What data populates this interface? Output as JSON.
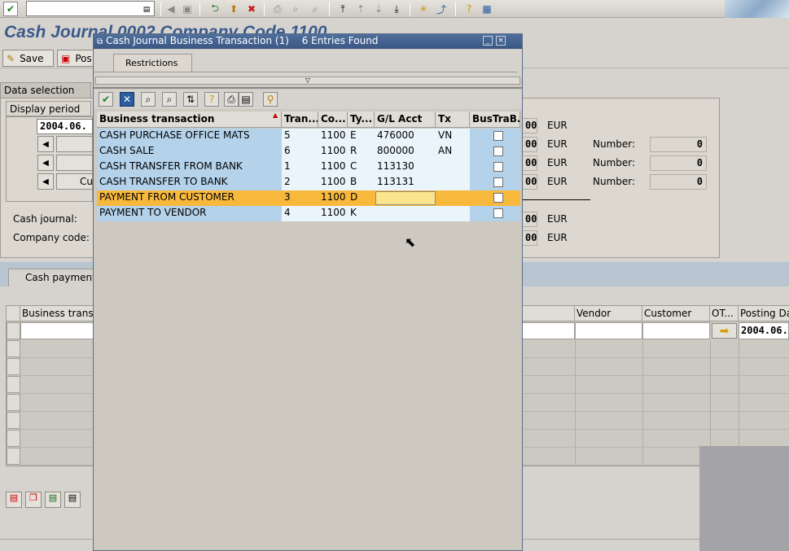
{
  "window_title": "Cash Journal 0002 Company Code 1100",
  "app_toolbar": {
    "save_label": "Save",
    "post_label": "Pos"
  },
  "left_panel": {
    "tab_data_selection": "Data selection",
    "display_period_label": "Display period",
    "period_value": "2004.06.",
    "btn3_text": "Cu",
    "cash_journal_label": "Cash journal:",
    "company_code_label": "Company code:"
  },
  "right_panel": {
    "amounts": [
      "00",
      "00",
      "00",
      "00",
      "00",
      "00"
    ],
    "currency": [
      "EUR",
      "EUR",
      "EUR",
      "EUR",
      "EUR",
      "EUR"
    ],
    "number_label": "Number:",
    "number_values": [
      "0",
      "0",
      "0"
    ]
  },
  "lower_tab": "Cash payment",
  "main_table": {
    "col_business": "Business transa",
    "col_vendor": "Vendor",
    "col_customer": "Customer",
    "col_ot": "OT...",
    "col_posting": "Posting Da",
    "posting_date_value": "2004.06."
  },
  "dialog": {
    "title": "Cash Journal Business Transaction (1)",
    "entries_found": "6 Entries Found",
    "tab_restrictions": "Restrictions",
    "columns": [
      "Business transaction",
      "Tran...",
      "Co...",
      "Ty...",
      "G/L Acct",
      "Tx",
      "BusTraB.."
    ],
    "rows": [
      {
        "name": "CASH PURCHASE OFFICE MATS",
        "tran": "5",
        "co": "1100",
        "ty": "E",
        "gl": "476000",
        "tx": "VN"
      },
      {
        "name": "CASH SALE",
        "tran": "6",
        "co": "1100",
        "ty": "R",
        "gl": "800000",
        "tx": "AN"
      },
      {
        "name": "CASH TRANSFER FROM BANK",
        "tran": "1",
        "co": "1100",
        "ty": "C",
        "gl": "113130",
        "tx": ""
      },
      {
        "name": "CASH TRANSFER TO BANK",
        "tran": "2",
        "co": "1100",
        "ty": "B",
        "gl": "113131",
        "tx": ""
      },
      {
        "name": "PAYMENT FROM CUSTOMER",
        "tran": "3",
        "co": "1100",
        "ty": "D",
        "gl": "",
        "tx": ""
      },
      {
        "name": "PAYMENT TO VENDOR",
        "tran": "4",
        "co": "1100",
        "ty": "K",
        "gl": "",
        "tx": ""
      }
    ]
  },
  "colors": {
    "title_blue": "#3a5a8c",
    "row_blue": "#b4d2ea",
    "row_light": "#eaf4fb",
    "selected_row": "#f7b83c"
  }
}
